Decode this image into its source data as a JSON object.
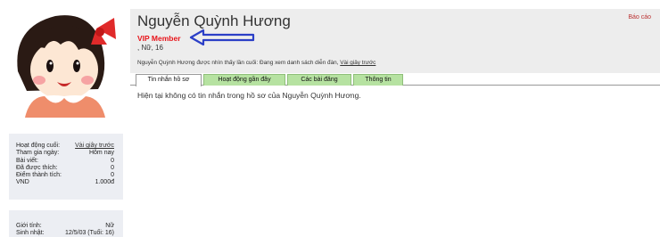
{
  "profile": {
    "name": "Nguyễn Quỳnh Hương",
    "member_title": "VIP Member",
    "demographics": ", Nữ, 16",
    "last_seen_prefix": "Nguyễn Quỳnh Hương được nhìn thấy lần cuối: Đang xem danh sách diễn đàn,",
    "last_seen_link": "Vài giây trước",
    "report_label": "Báo cáo"
  },
  "tabs": [
    {
      "label": "Tin nhắn hồ sơ",
      "active": true
    },
    {
      "label": "Hoạt động gần đây",
      "active": false
    },
    {
      "label": "Các bài đăng",
      "active": false
    },
    {
      "label": "Thông tin",
      "active": false
    }
  ],
  "empty_message": "Hiện tại không có tin nhắn trong hồ sơ của Nguyễn Quỳnh Hương.",
  "stats": [
    {
      "label": "Hoạt động cuối:",
      "value": "Vài giây trước",
      "link": true
    },
    {
      "label": "Tham gia ngày:",
      "value": "Hôm nay",
      "link": false
    },
    {
      "label": "Bài viết:",
      "value": "0",
      "link": false
    },
    {
      "label": "Đã được thích:",
      "value": "0",
      "link": false
    },
    {
      "label": "Điểm thành tích:",
      "value": "0",
      "link": false
    },
    {
      "label": "VND",
      "value": "1.000đ",
      "link": false
    }
  ],
  "info": [
    {
      "label": "Giới tính:",
      "value": "Nữ"
    },
    {
      "label": "Sinh nhật:",
      "value": "12/5/03 (Tuổi: 16)"
    }
  ],
  "colors": {
    "vip": "#e8141a",
    "tab_inactive": "#b6e2a1",
    "arrow": "#2b3fc7",
    "sidebar_bg": "#eceef3",
    "header_bg": "#ededed"
  },
  "icons": {
    "avatar": "cartoon-girl-avatar",
    "arrow": "left-arrow-annotation"
  }
}
